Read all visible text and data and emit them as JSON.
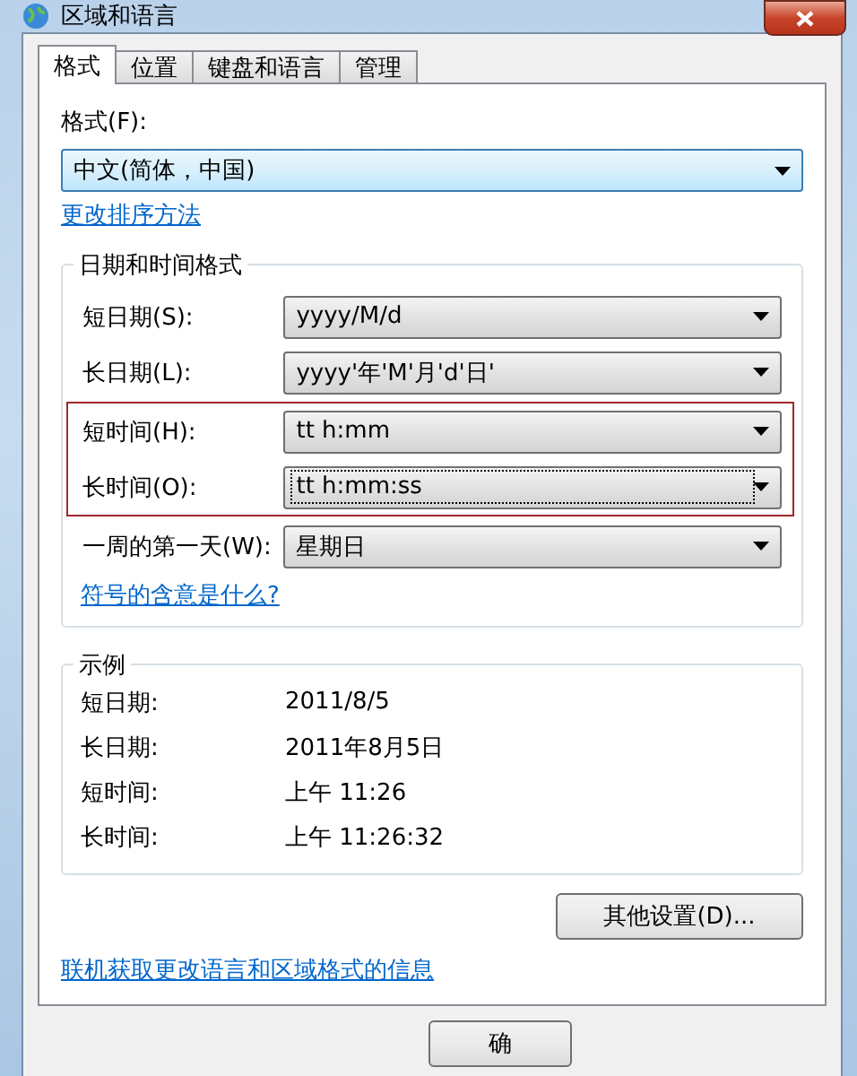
{
  "window": {
    "title": "区域和语言"
  },
  "tabs": [
    {
      "label": "格式",
      "selected": true
    },
    {
      "label": "位置",
      "selected": false
    },
    {
      "label": "键盘和语言",
      "selected": false
    },
    {
      "label": "管理",
      "selected": false
    }
  ],
  "format": {
    "label": "格式(F):",
    "value": "中文(简体，中国)",
    "link": "更改排序方法"
  },
  "date_time_formats": {
    "title": "日期和时间格式",
    "rows": [
      {
        "label": "短日期(S):",
        "value": "yyyy/M/d",
        "focused": false,
        "highlighted": false
      },
      {
        "label": "长日期(L):",
        "value": "yyyy'年'M'月'd'日'",
        "focused": false,
        "highlighted": false
      },
      {
        "label": "短时间(H):",
        "value": "tt h:mm",
        "focused": false,
        "highlighted": true
      },
      {
        "label": "长时间(O):",
        "value": "tt h:mm:ss",
        "focused": true,
        "highlighted": true
      },
      {
        "label": "一周的第一天(W):",
        "value": "星期日",
        "focused": false,
        "highlighted": false
      }
    ],
    "link": "符号的含意是什么?"
  },
  "examples": {
    "title": "示例",
    "rows": [
      {
        "label": "短日期:",
        "value": "2011/8/5"
      },
      {
        "label": "长日期:",
        "value": "2011年8月5日"
      },
      {
        "label": "短时间:",
        "value": "上午 11:26"
      },
      {
        "label": "长时间:",
        "value": "上午 11:26:32"
      }
    ]
  },
  "other_settings_button": "其他设置(D)...",
  "online_link": "联机获取更改语言和区域格式的信息",
  "buttons": [
    "确"
  ]
}
